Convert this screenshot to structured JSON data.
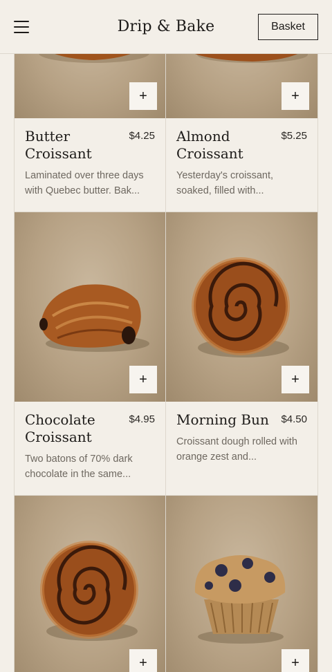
{
  "header": {
    "brand": "Drip & Bake",
    "basket_label": "Basket"
  },
  "products": [
    {
      "name": "Butter Croissant",
      "price": "$4.25",
      "description": "Laminated over three days with Quebec butter. Bak...",
      "icon": "croissant"
    },
    {
      "name": "Almond Croissant",
      "price": "$5.25",
      "description": "Yesterday's croissant, soaked, filled with...",
      "icon": "croissant"
    },
    {
      "name": "Chocolate Croissant",
      "price": "$4.95",
      "description": "Two batons of 70% dark chocolate in the same...",
      "icon": "pain-au-chocolat"
    },
    {
      "name": "Morning Bun",
      "price": "$4.50",
      "description": "Croissant dough rolled with orange zest and...",
      "icon": "morning-bun"
    },
    {
      "name": "",
      "price": "",
      "description": "",
      "icon": "morning-bun"
    },
    {
      "name": "",
      "price": "",
      "description": "",
      "icon": "blueberry-muffin"
    }
  ],
  "add_label": "+",
  "colors": {
    "background": "#f3efe8",
    "border": "#ddd7cd",
    "text": "#1d1b19",
    "muted": "#6e6860"
  }
}
